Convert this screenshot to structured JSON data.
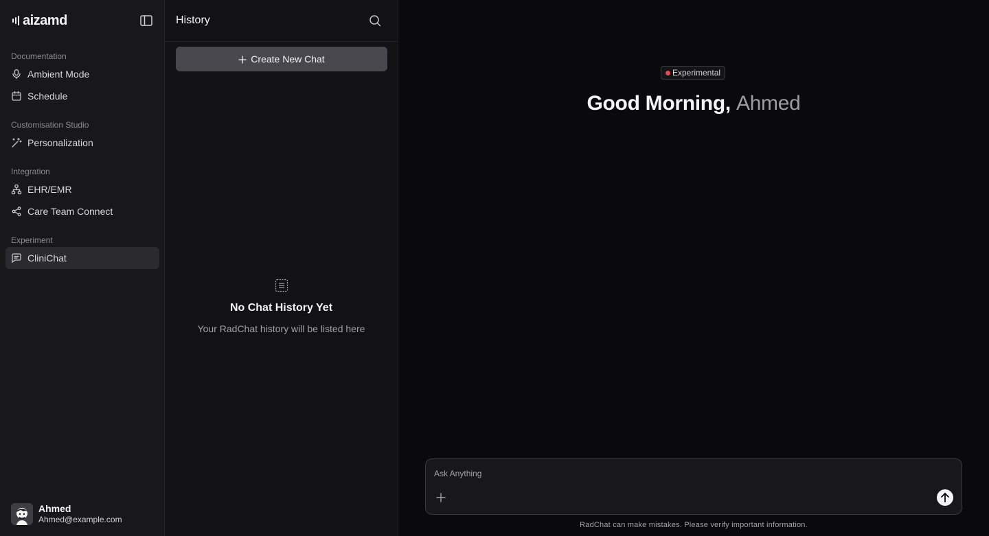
{
  "app": {
    "logo_text": "aizamd"
  },
  "sidebar": {
    "sections": [
      {
        "title": "Documentation",
        "items": [
          {
            "label": "Ambient Mode",
            "icon": "mic-icon"
          },
          {
            "label": "Schedule",
            "icon": "calendar-icon"
          }
        ]
      },
      {
        "title": "Customisation Studio",
        "items": [
          {
            "label": "Personalization",
            "icon": "magic-wand-icon"
          }
        ]
      },
      {
        "title": "Integration",
        "items": [
          {
            "label": "EHR/EMR",
            "icon": "network-icon"
          },
          {
            "label": "Care Team Connect",
            "icon": "share-icon"
          }
        ]
      },
      {
        "title": "Experiment",
        "items": [
          {
            "label": "CliniChat",
            "icon": "chat-icon",
            "active": true
          }
        ]
      }
    ],
    "user": {
      "name": "Ahmed",
      "email": "Ahmed@example.com"
    }
  },
  "history": {
    "title": "History",
    "create_label": "Create New Chat",
    "empty_title": "No Chat History Yet",
    "empty_subtitle": "Your RadChat history will be listed here"
  },
  "main": {
    "badge": "Experimental",
    "greeting": "Good Morning,",
    "greeting_name": "Ahmed",
    "input_placeholder": "Ask Anything",
    "disclaimer": "RadChat can make mistakes. Please verify important information."
  },
  "colors": {
    "accent_dot": "#e5484d",
    "active_item": "#2a2a2f",
    "button": "#47474d"
  }
}
